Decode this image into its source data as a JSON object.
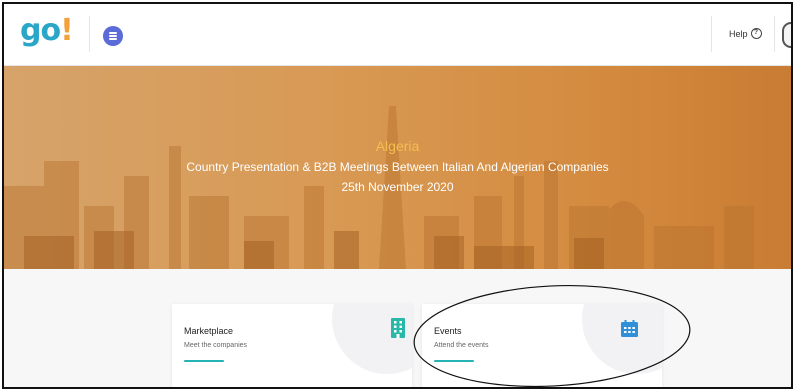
{
  "header": {
    "logo": {
      "part1": "go",
      "part2": "!"
    },
    "help_label": "Help",
    "help_icon": "question-circle-icon",
    "menu_icon": "hamburger-menu-icon",
    "avatar_icon": "user-avatar-icon"
  },
  "banner": {
    "country": "Algeria",
    "subtitle": "Country Presentation & B2B Meetings Between Italian And Algerian Companies",
    "date": "25th November 2020"
  },
  "cards": [
    {
      "title": "Marketplace",
      "subtitle": "Meet the companies",
      "icon": "building-icon"
    },
    {
      "title": "Events",
      "subtitle": "Attend the events",
      "icon": "calendar-icon"
    }
  ],
  "colors": {
    "brand_teal": "#2aa6c9",
    "brand_orange": "#f2a23a",
    "menu_button": "#5b6bd8",
    "accent_line": "#26b3b6",
    "banner_country": "#f6bd4e"
  }
}
